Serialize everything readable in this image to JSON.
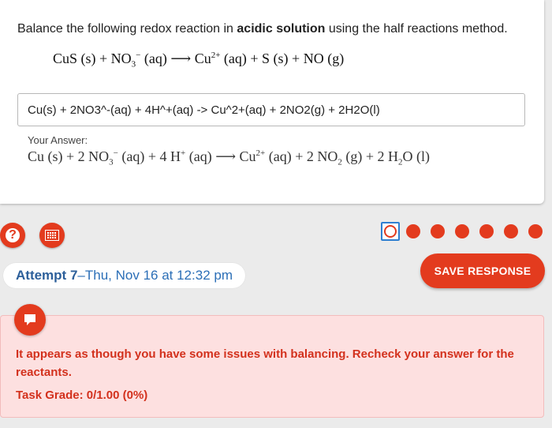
{
  "question": {
    "instructions_prefix": "Balance the following redox reaction in ",
    "instructions_bold": "acidic solution",
    "instructions_suffix": " using the half reactions method.",
    "equation": {
      "lhs1": "CuS (s) + NO",
      "lhs1_sub": "3",
      "lhs1_sup": "−",
      "lhs1_state": " (aq) ",
      "arrow": "⟶",
      "rhs1": " Cu",
      "rhs1_sup": "2+",
      "rhs_rest": " (aq) + S (s) + NO (g)"
    }
  },
  "answer_input": {
    "value": "Cu(s) + 2NO3^-(aq) + 4H^+(aq) -> Cu^2+(aq) + 2NO2(g) + 2H2O(l)"
  },
  "rendered_answer": {
    "label": "Your Answer:",
    "p1": "Cu (s) + 2 NO",
    "p1_sub": "3",
    "p1_sup": "−",
    "p2": " (aq) + 4 H",
    "p2_sup": "+",
    "p3": " (aq) ⟶ Cu",
    "p3_sup": "2+",
    "p4": " (aq) + 2 NO",
    "p4_sub": "2",
    "p5": " (g) + 2 H",
    "p5_sub": "2",
    "p6": "O (l)"
  },
  "tools": {
    "help_icon": "question-icon",
    "calculator_icon": "calculator-icon"
  },
  "attempt_dots": {
    "current_index": 0,
    "total": 7
  },
  "attempt": {
    "label": "Attempt 7",
    "separator": " – ",
    "timestamp": "Thu, Nov 16 at 12:32 pm"
  },
  "save_button": {
    "label": "SAVE RESPONSE"
  },
  "feedback": {
    "icon": "message-icon",
    "message": "It appears as though you have some issues with balancing. Recheck your answer for the reactants.",
    "grade": "Task Grade: 0/1.00 (0%)"
  },
  "colors": {
    "accent": "#e33b1e",
    "link_blue": "#2c6fb7",
    "feedback_bg": "#fde0e0",
    "feedback_text": "#d3311d"
  }
}
